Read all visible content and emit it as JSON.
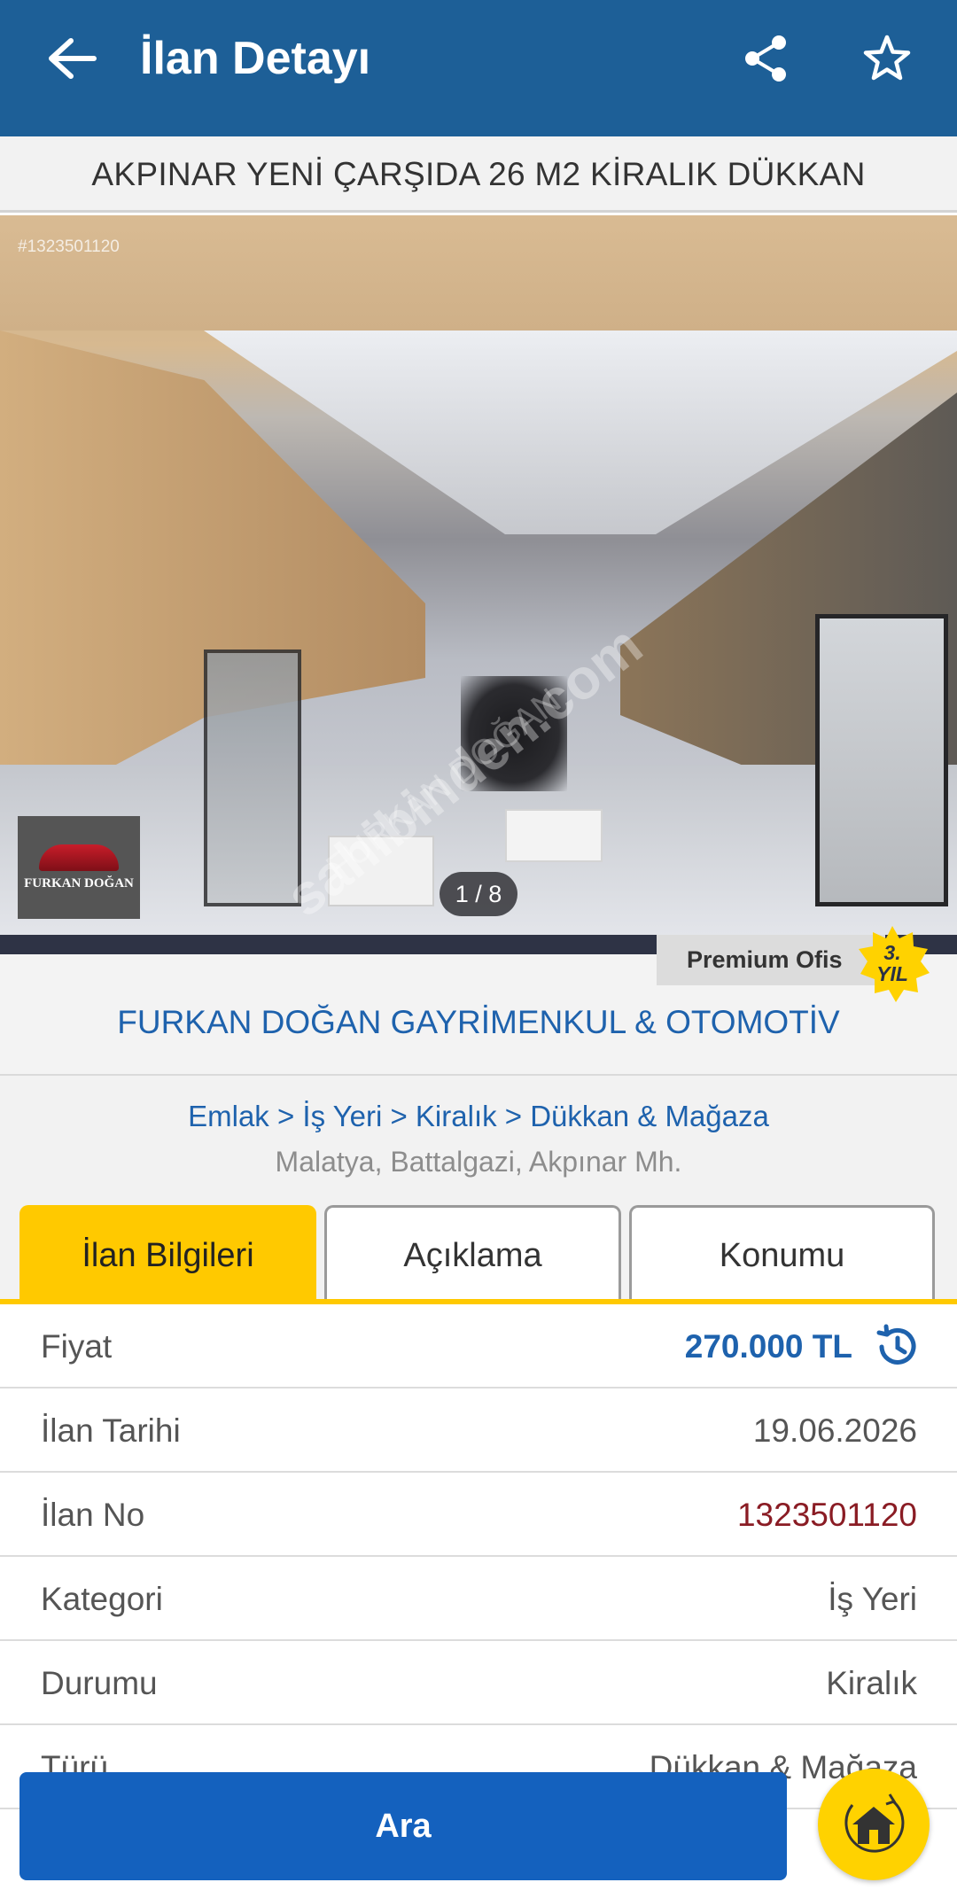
{
  "appbar": {
    "title": "İlan Detayı",
    "back_icon": "arrow-left",
    "share_icon": "share",
    "favorite_icon": "star-outline",
    "background": "#1d5f97"
  },
  "listing": {
    "title": "AKPINAR YENİ ÇARŞIDA 26 M2 KİRALIK DÜKKAN"
  },
  "photo": {
    "id_overlay": "#1323501120",
    "counter": "1 / 8",
    "logo_text": "FURKAN DOĞAN",
    "watermark": "sahibinden.com",
    "watermark_name": "FURKAN DOĞAN"
  },
  "store": {
    "premium_label": "Premium Ofis",
    "badge_line1": "3.",
    "badge_line2": "YIL",
    "name": "FURKAN DOĞAN GAYRİMENKUL & OTOMOTİV"
  },
  "category": {
    "breadcrumb": "Emlak > İş Yeri > Kiralık > Dükkan & Mağaza",
    "location": "Malatya, Battalgazi, Akpınar Mh."
  },
  "tabs": [
    {
      "label": "İlan Bilgileri",
      "active": true
    },
    {
      "label": "Açıklama",
      "active": false
    },
    {
      "label": "Konumu",
      "active": false
    }
  ],
  "details": [
    {
      "label": "Fiyat",
      "value": "270.000 TL"
    },
    {
      "label": "İlan Tarihi",
      "value": "19.06.2026"
    },
    {
      "label": "İlan No",
      "value": "1323501120"
    },
    {
      "label": "Kategori",
      "value": "İş Yeri"
    },
    {
      "label": "Durumu",
      "value": "Kiralık"
    },
    {
      "label": "Türü",
      "value": "Dükkan & Mağaza"
    }
  ],
  "actions": {
    "call_label": "Ara",
    "home_icon": "home"
  },
  "colors": {
    "accent_blue": "#1e62ad",
    "tab_yellow": "#ffc900",
    "call_button": "#1461be",
    "fab_yellow": "#ffd200",
    "listing_no": "#8a1c24"
  }
}
